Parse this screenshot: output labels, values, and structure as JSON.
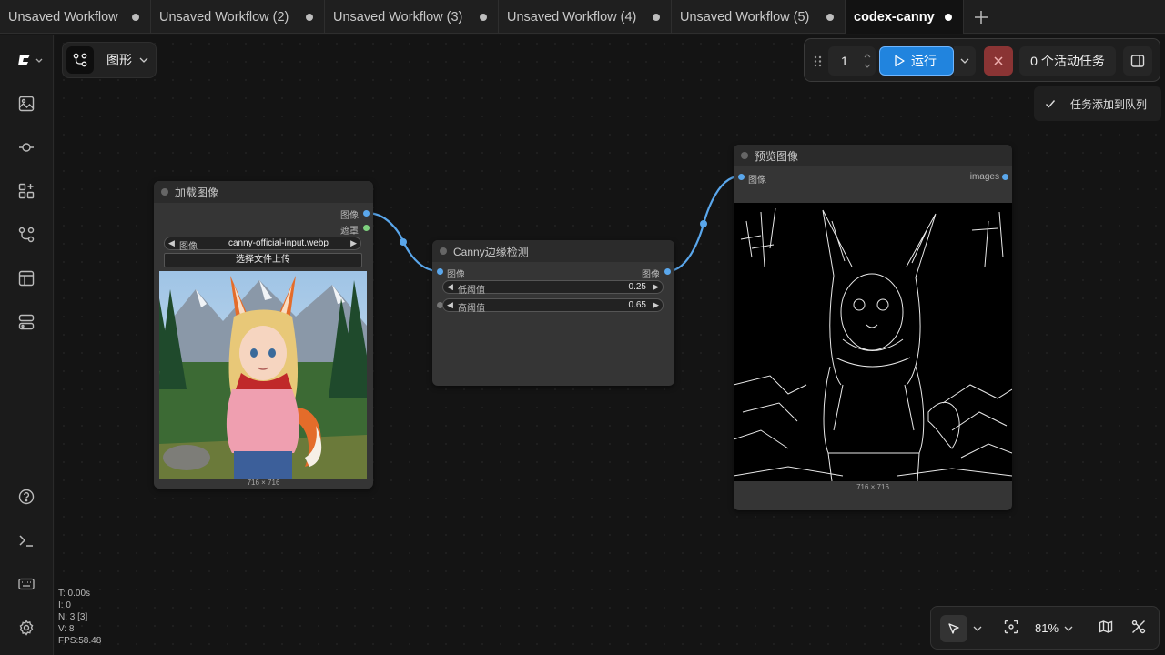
{
  "tabs": [
    {
      "label": "Unsaved Workflow"
    },
    {
      "label": "Unsaved Workflow (2)"
    },
    {
      "label": "Unsaved Workflow (3)"
    },
    {
      "label": "Unsaved Workflow (4)"
    },
    {
      "label": "Unsaved Workflow (5)"
    },
    {
      "label": "codex-canny"
    }
  ],
  "toolbar": {
    "graph_label": "图形",
    "run_count": "1",
    "run_label": "运行",
    "tasks_label": "0 个活动任务"
  },
  "toast": {
    "message": "任务添加到队列"
  },
  "nodes": {
    "load_image": {
      "title": "加载图像",
      "output_image": "图像",
      "output_mask": "遮罩",
      "widget_label": "图像",
      "widget_value": "canny-official-input.webp",
      "upload_label": "选择文件上传",
      "size": "716 × 716"
    },
    "canny": {
      "title": "Canny边缘检测",
      "input_image": "图像",
      "output_image": "图像",
      "low_label": "低阈值",
      "low_value": "0.25",
      "high_label": "高阈值",
      "high_value": "0.65"
    },
    "preview": {
      "title": "预览图像",
      "input_image": "图像",
      "output_images": "images",
      "size": "716 × 716"
    }
  },
  "zoom": "81%",
  "stats": {
    "t": "T: 0.00s",
    "i": "I: 0",
    "n": "N: 3 [3]",
    "v": "V: 8",
    "fps": "FPS:58.48"
  },
  "colors": {
    "accent": "#2184de",
    "link": "#5aa7ec",
    "mask_slot": "#7ed07e",
    "stop": "#8a3434"
  }
}
